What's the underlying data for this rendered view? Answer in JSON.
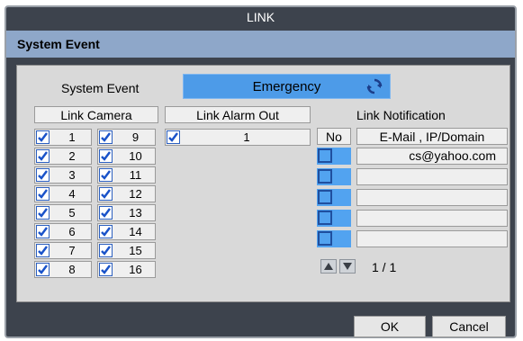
{
  "window": {
    "title": "LINK",
    "subtitle": "System Event"
  },
  "system_event": {
    "label": "System Event",
    "value": "Emergency",
    "icon": "sync-icon"
  },
  "headers": {
    "link_camera": "Link Camera",
    "link_alarm_out": "Link Alarm Out",
    "link_notification": "Link Notification"
  },
  "cameras_left": [
    {
      "n": "1",
      "checked": true
    },
    {
      "n": "2",
      "checked": true
    },
    {
      "n": "3",
      "checked": true
    },
    {
      "n": "4",
      "checked": true
    },
    {
      "n": "5",
      "checked": true
    },
    {
      "n": "6",
      "checked": true
    },
    {
      "n": "7",
      "checked": true
    },
    {
      "n": "8",
      "checked": true
    }
  ],
  "cameras_right": [
    {
      "n": "9",
      "checked": true
    },
    {
      "n": "10",
      "checked": true
    },
    {
      "n": "11",
      "checked": true
    },
    {
      "n": "12",
      "checked": true
    },
    {
      "n": "13",
      "checked": true
    },
    {
      "n": "14",
      "checked": true
    },
    {
      "n": "15",
      "checked": true
    },
    {
      "n": "16",
      "checked": true
    }
  ],
  "alarm_out": [
    {
      "n": "1",
      "checked": true
    }
  ],
  "notification": {
    "no_header": "No",
    "email_header": "E-Mail , IP/Domain",
    "rows": [
      {
        "email": "cs@yahoo.com"
      },
      {
        "email": ""
      },
      {
        "email": ""
      },
      {
        "email": ""
      },
      {
        "email": ""
      }
    ],
    "page": "1 / 1"
  },
  "buttons": {
    "ok": "OK",
    "cancel": "Cancel"
  }
}
